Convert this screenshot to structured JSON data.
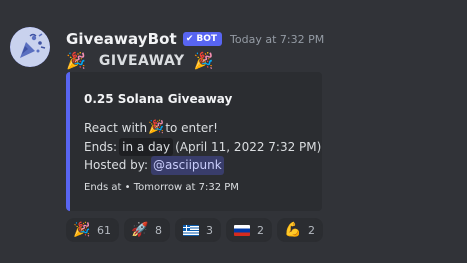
{
  "message": {
    "username": "GiveawayBot",
    "badge": "BOT",
    "timestamp": "Today at 7:32 PM",
    "content": "GIVEAWAY",
    "content_emoji_left": "🎉",
    "content_emoji_right": "🎉"
  },
  "embed": {
    "accent_color": "#5865f2",
    "title": "0.25 Solana Giveaway",
    "react_prefix": "React with",
    "react_emoji": "🎉",
    "react_suffix": "to enter!",
    "ends_label": "Ends:",
    "ends_relative": "in a day",
    "ends_absolute": "(April 11, 2022 7:32 PM)",
    "hosted_label": "Hosted by:",
    "host_mention": "@asciipunk",
    "footer": "Ends at • Tomorrow at 7:32 PM"
  },
  "reactions": [
    {
      "icon": "party-popper",
      "emoji": "🎉",
      "count": "61"
    },
    {
      "icon": "rocket",
      "emoji": "🚀",
      "count": "8"
    },
    {
      "icon": "greece-flag",
      "emoji": "",
      "count": "3"
    },
    {
      "icon": "russia-flag",
      "emoji": "",
      "count": "2"
    },
    {
      "icon": "flexed-biceps",
      "emoji": "💪",
      "count": "2"
    }
  ]
}
